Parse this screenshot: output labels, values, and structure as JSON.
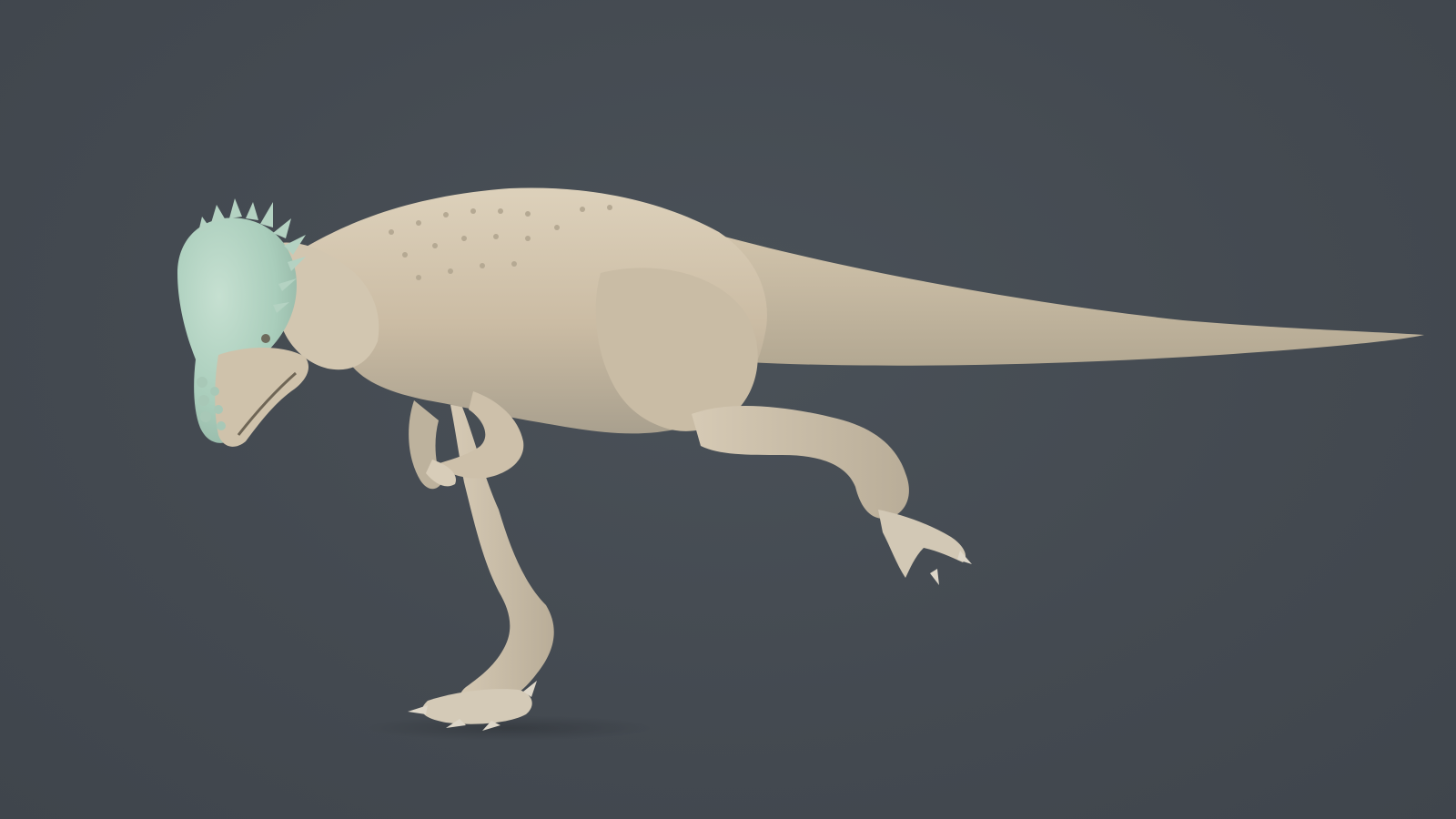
{
  "scene": {
    "subject_icon": "dinosaur-sculpt-icon",
    "colors": {
      "background": "#434950",
      "skin": "#cfc0a8",
      "skin_shadow": "#a9a08e",
      "skin_highlight": "#e2d7c3",
      "head_tint": "#a9cdbb",
      "claw": "#ddd6c8"
    }
  }
}
